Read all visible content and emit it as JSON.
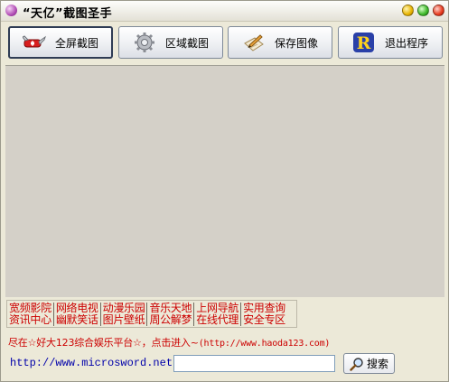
{
  "window": {
    "title": "“天亿”截图圣手"
  },
  "toolbar": {
    "fullscreen_label": "全屏截图",
    "region_label": "区域截图",
    "save_label": "保存图像",
    "exit_label": "退出程序"
  },
  "links": {
    "row1": [
      "宽频影院",
      "网络电视",
      "动漫乐园",
      "音乐天地",
      "上网导航",
      "实用查询"
    ],
    "row2": [
      "资讯中心",
      "幽默笑话",
      "图片壁纸",
      "周公解梦",
      "在线代理",
      "安全专区"
    ]
  },
  "promo": {
    "text": "尽在☆好大123综合娱乐平台☆，点击进入~",
    "url": "(http://www.haoda123.com)"
  },
  "footer": {
    "site_url": "http://www.microsword.net",
    "search_value": "",
    "search_label": "搜索"
  }
}
